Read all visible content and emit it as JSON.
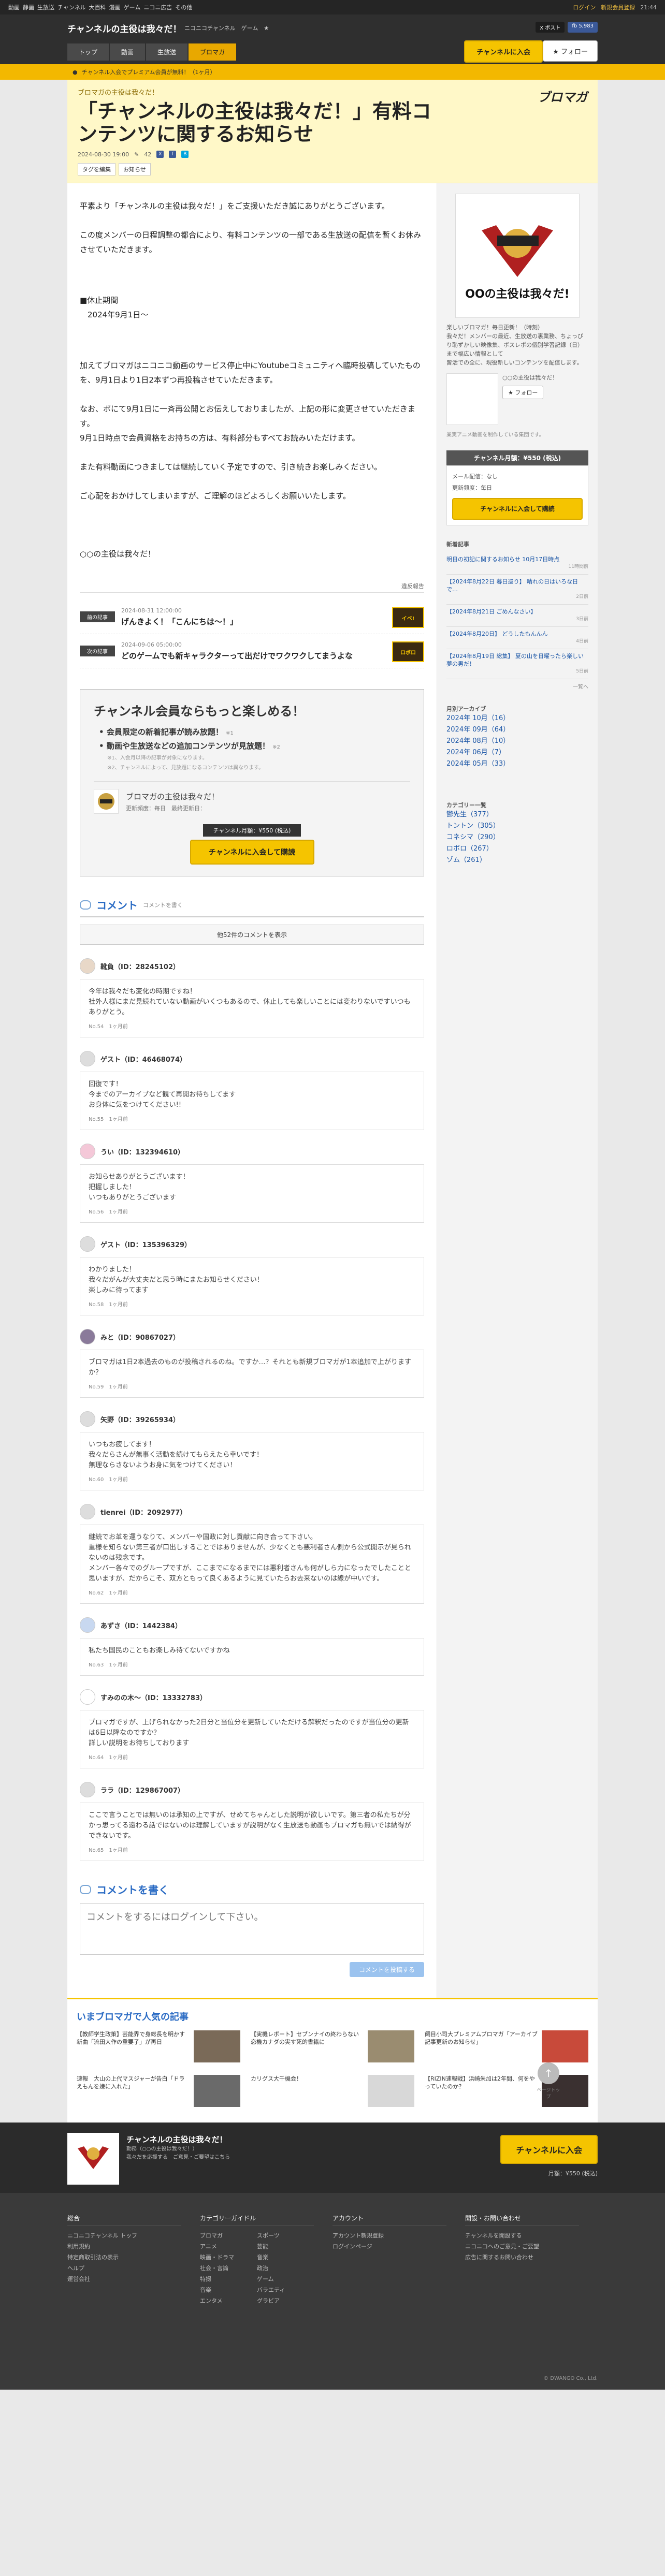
{
  "gbar": {
    "left": [
      "動画",
      "静画",
      "生放送",
      "チャンネル",
      "大百科",
      "漫画",
      "ゲーム",
      "ニコニ広告",
      "その他"
    ],
    "login": "ログイン",
    "signup": "新規会員登録",
    "time": "21:44"
  },
  "header": {
    "channel_title": "チャンネルの主役は我々だ！",
    "brand": "ニコニコチャンネル　ゲーム　★",
    "share_x": "X ポスト",
    "share_fb": "fb 5,983",
    "nav": [
      "トップ",
      "動画",
      "生放送",
      "ブロマガ"
    ],
    "join": "チャンネルに入会",
    "follow": "★ フォロー"
  },
  "notice": "チャンネル入会でプレミアム会員が無料！（1ヶ月）",
  "article": {
    "channel_name": "ブロマガの主役は我々だ！",
    "title": "「チャンネルの主役は我々だ！」有料コンテンツに関するお知らせ",
    "date": "2024-08-30 19:00",
    "count": "42",
    "tags": [
      "タグを編集",
      "お知らせ"
    ],
    "logo": "ブロマガ",
    "p1": "平素より「チャンネルの主役は我々だ！」をご支援いただき誠にありがとうございます。",
    "p2": "この度メンバーの日程調整の都合により、有料コンテンツの一部である生放送の配信を暫くお休みさせていただきます。",
    "p3": "■休止期間",
    "p4": "　2024年9月1日～",
    "p5": "加えてブロマガはニコニコ動画のサービス停止中にYoutubeコミュニティへ臨時投稿していたものを、9月1日より1日2本ずつ再投稿させていただきます。",
    "p6": "なお、ポにて9月1日に一斉再公開とお伝えしておりましたが、上記の形に変更させていただきます。",
    "p7": "9月1日時点で会員資格をお持ちの方は、有料部分もすべてお読みいただけます。",
    "p8": "また有料動画につきましては継続していく予定ですので、引き続きお楽しみください。",
    "p9": "ご心配をおかけしてしまいますが、ご理解のほどよろしくお願いいたします。",
    "p10": "○○の主役は我々だ！",
    "report": "違反報告"
  },
  "prevnext": [
    {
      "badge": "前の記事",
      "date": "2024-08-31 12:00:00",
      "title": "げんきよく！「こんにちは～！」",
      "thumb": "イベ!"
    },
    {
      "badge": "次の記事",
      "date": "2024-09-06 05:00:00",
      "title": "どのゲームでも新キャラクターって出だけでワクワクしてまうよな",
      "thumb": "ロボロ"
    }
  ],
  "member_box": {
    "title": "チャンネル会員ならもっと楽しめる！",
    "ben1": "会員限定の新着記事が読み放題！",
    "ben1_note": "※1",
    "ben2": "動画や生放送などの追加コンテンツが見放題！",
    "ben2_note": "※2",
    "note1": "※1、入会月以降の記事が対象になります。",
    "note2": "※2、チャンネルによって、見放題になるコンテンツは異なります。",
    "mini_name": "ブロマガの主役は我々だ！",
    "mini_upd": "更新頻度：毎日　最終更新日：",
    "price": "チャンネル月額：¥550 (税込)",
    "join": "チャンネルに入会して購読"
  },
  "comments": {
    "title": "コメント",
    "sub": "コメントを書く",
    "show_prev": "他52件のコメントを表示",
    "items": [
      {
        "name": "靴負（ID：28245102）",
        "text": "今年は我々だも変化の時期ですね！\n社外人様にまだ見続れていない動画がいくつもあるので、休止しても楽しいことには変わりないですいつもありがとう。",
        "no": "No.54　1ヶ月前"
      },
      {
        "name": "ゲスト（ID：46468074）",
        "text": "回復です！\n今までのアーカイブなど観て再開お待ちしてます\nお身体に気をつけてください!!",
        "no": "No.55　1ヶ月前"
      },
      {
        "name": "うい（ID：132394610）",
        "text": "お知らせありがとうございます！\n把握しました！\nいつもありがとうございます",
        "no": "No.56　1ヶ月前"
      },
      {
        "name": "ゲスト（ID：135396329）",
        "text": "わかりました！\n我々だがんが大丈夫だと思う時にまたお知らせください！\n楽しみに待ってます",
        "no": "No.58　1ヶ月前"
      },
      {
        "name": "みと（ID：90867027）",
        "text": "ブロマガは1日2本過去のものが投稿されるのね。ですか…？それとも新規ブロマガが1本追加で上がりますか？",
        "no": "No.59　1ヶ月前"
      },
      {
        "name": "矢野（ID：39265934）",
        "text": "いつもお疲してます！\n我々だらさんが無事く活動を続けてもらえたら幸いです！\n無理ならさないようお身に気をつけてください！",
        "no": "No.60　1ヶ月前"
      },
      {
        "name": "tienrei（ID：2092977）",
        "text": "継続でお革を運うなりて、メンバーや国政に対し貢献に向き合って下さい。\n重様を知らない第三者が口出しすることではありませんが、少なくとも悪利者さん側から公式開示が見られないのは残念です。\nメンバー各々でのグループですが、ここまでになるまでには悪利者さんも何がしら力になったでしたことと思いますが、だからこそ、双方ともって良くあるように見ていたらお去来ないのは線が中いです。",
        "no": "No.62　1ヶ月前"
      },
      {
        "name": "あずさ（ID：1442384）",
        "text": "私たち国民のこともお楽しみ待てないですかね",
        "no": "No.63　1ヶ月前"
      },
      {
        "name": "すみのの木～（ID：13332783）",
        "text": "ブロマガですが、上げられなかった2日分と当位分を更新していただける解釈だったのですが当位分の更新は6日以降なのですか？\n詳しい説明をお待ちしております",
        "no": "No.64　1ヶ月前"
      },
      {
        "name": "ララ（ID：129867007）",
        "text": "ここで言うことでは無いのは承知の上ですが、せめてちゃんとした説明が欲しいです。第三者の私たちが分かっ思ってる遠わる話ではないのは理解していますが説明がなく生放送も動画もブロマガも無いでは納得ができないです。",
        "no": "No.65　1ヶ月前"
      }
    ]
  },
  "write": {
    "title": "コメントを書く",
    "placeholder": "コメントをするにはログインして下さい。",
    "post": "コメントを投稿する"
  },
  "side": {
    "logo_caption": "OOの主役は我々だ!",
    "desc": "楽しいブロマガ！毎日更新！（時刻）",
    "desc2": "我々だ！メンバーの最近、生放送の裏業務、ちょっぴり恥ずかしい映像集、ボスレポの個別学習記録（日）まで幅広い情報として",
    "desc3": "皆活での全に、現役新しいコンテンツを配信します。",
    "author": "○○の主役は我々だ！",
    "follow": "フォロー",
    "sub": "業実アニメ動画を制作している集団です。",
    "price": "チャンネル月額：¥550 (税込)",
    "detail1": "メール配信：なし",
    "detail2": "更新頻度：毎日",
    "join": "チャンネルに入会して購読",
    "new_title": "新着記事",
    "new_list": [
      {
        "t": "明日の初記に関するお知らせ 10月17日時点",
        "d": "11時間前"
      },
      {
        "t": "【2024年8月22日 暮日巡り】 晴れの日はいろな日で…",
        "d": "2日前"
      },
      {
        "t": "【2024年8月21日 ごめんなさい】",
        "d": "3日前"
      },
      {
        "t": "【2024年8月20日】 どうしたもんんん",
        "d": "4日前"
      },
      {
        "t": "【2024年8月19日 総集】 夏の山を日曜ったら楽しい夢の男だ！",
        "d": "5日前"
      }
    ],
    "more": "一覧へ",
    "arc_title": "月別アーカイブ",
    "arc": [
      "2024年 10月（16）",
      "2024年 09月（64）",
      "2024年 08月（10）",
      "2024年 06月（7）",
      "2024年 05月（33）"
    ],
    "cat_title": "カテゴリー一覧",
    "cat": [
      "鬱先生（377）",
      "トントン（305）",
      "コネシマ（290）",
      "ロボロ（267）",
      "ゾム（261）"
    ]
  },
  "gotop": "ページトップ",
  "popular": {
    "title": "いまブロマガで人気の記事",
    "items": [
      "【教師学生政策】芸能界で身総長を明かす新曲「流田大作の重要子」が再日",
      "【実機レポート】セブンナイの終わらない恋機カナダの実す死的書籍に",
      "飼目小司大プレミアムブロマガ「アーカイブ記事更新のお知らせ」",
      "速報　大山の上代マスジャーが告白「ドラえもんを嫌に入れた」",
      "カリグス大千機会！",
      "【RIZIN速報戦】浜崎朱加は2年間、何をやっていたのか？"
    ]
  },
  "footer_ch": {
    "name": "チャンネルの主役は我々だ！",
    "desc": "勤務（○○の主役は我々だ！）",
    "desc2": "我々だを応援する　ご意見・ご要望はこちら",
    "join": "チャンネルに入会",
    "price": "月額：¥550 (税込)"
  },
  "footer": {
    "cols": [
      {
        "h": "総合",
        "items": [
          "ニコニコチャンネル トップ",
          "利用規約",
          "特定商取引法の表示",
          "ヘルプ",
          "運営会社"
        ]
      },
      {
        "h": "カテゴリーガイドル",
        "items": [
          "ブロマガ",
          "アニメ",
          "映画・ドラマ",
          "社会・言論",
          "特撮",
          "音楽",
          "エンタメ"
        ],
        "items2": [
          "スポーツ",
          "芸能",
          "音楽",
          "政治",
          "ゲーム",
          "バラエティ",
          "グラビア"
        ]
      },
      {
        "h": "アカウント",
        "items": [
          "アカウント新規登録",
          "ログインページ"
        ]
      },
      {
        "h": "開設・お問い合わせ",
        "items": [
          "チャンネルを開設する",
          "ニコニコへのご意見・ご要望",
          "広告に関するお問い合わせ"
        ]
      }
    ],
    "copy": "© DWANGO Co., Ltd."
  }
}
